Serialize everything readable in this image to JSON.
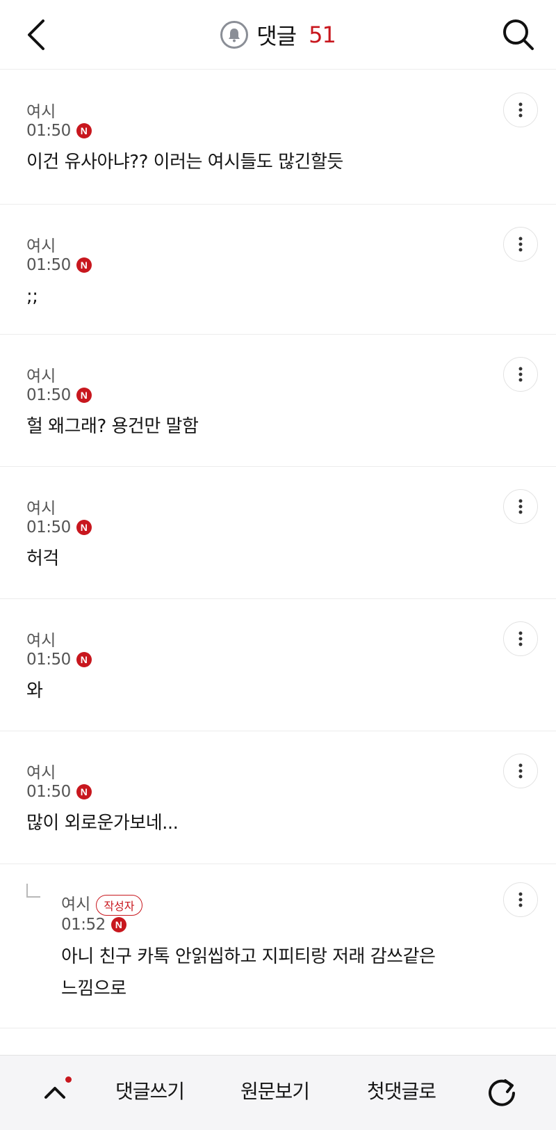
{
  "header": {
    "title": "댓글",
    "count": "51",
    "icons": {
      "back": "back-chevron-icon",
      "notify": "bell-icon",
      "search": "search-icon"
    }
  },
  "comments": [
    {
      "author": "여시",
      "time": "01:50",
      "badge": "N",
      "text": "이건 유사아냐?? 이러는 여시들도 많긴할듯",
      "is_reply": false
    },
    {
      "author": "여시",
      "time": "01:50",
      "badge": "N",
      "text": ";;",
      "is_reply": false
    },
    {
      "author": "여시",
      "time": "01:50",
      "badge": "N",
      "text": "헐 왜그래? 용건만 말함",
      "is_reply": false
    },
    {
      "author": "여시",
      "time": "01:50",
      "badge": "N",
      "text": "허걱",
      "is_reply": false
    },
    {
      "author": "여시",
      "time": "01:50",
      "badge": "N",
      "text": "와",
      "is_reply": false
    },
    {
      "author": "여시",
      "time": "01:50",
      "badge": "N",
      "text": "많이 외로운가보네...",
      "is_reply": false
    },
    {
      "author": "여시",
      "tag": "작성자",
      "time": "01:52",
      "badge": "N",
      "text_line1": "아니 친구 카톡 안읽씹하고 지피티랑 저래 감쓰같은",
      "text_line2": "느낌으로",
      "is_reply": true
    }
  ],
  "bottom_bar": {
    "write_comment": "댓글쓰기",
    "view_original": "원문보기",
    "to_first_comment": "첫댓글로",
    "icons": {
      "up": "chevron-up-icon",
      "refresh": "refresh-icon"
    }
  },
  "colors": {
    "accent": "#c8171e",
    "text": "#151515",
    "muted": "#555555",
    "divider": "#ececec",
    "bottom_bg": "#f5f5f7"
  }
}
